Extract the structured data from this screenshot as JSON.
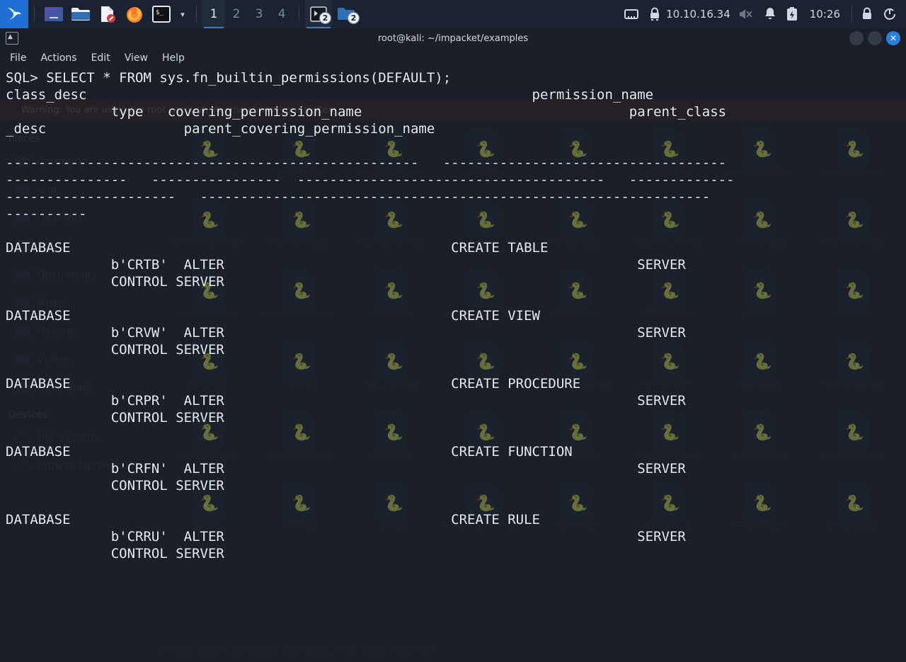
{
  "taskbar": {
    "launchers": [
      {
        "name": "kali-menu-icon",
        "glyph": "kali-dragon"
      },
      {
        "name": "workspace-preview-icon",
        "glyph": "screen"
      },
      {
        "name": "file-manager-icon",
        "glyph": "folder"
      },
      {
        "name": "text-editor-icon",
        "glyph": "document"
      },
      {
        "name": "firefox-icon",
        "glyph": "firefox"
      },
      {
        "name": "terminal-icon",
        "glyph": "terminal"
      }
    ],
    "terminal_prompt": "$_",
    "chevron": "▾",
    "workspaces": [
      {
        "label": "1",
        "active": true
      },
      {
        "label": "2",
        "active": false
      },
      {
        "label": "3",
        "active": false
      },
      {
        "label": "4",
        "active": false
      }
    ],
    "windows": [
      {
        "name": "terminal-window-group",
        "badge": "2",
        "active": true
      },
      {
        "name": "file-manager-window-group",
        "badge": "2",
        "active": false
      }
    ],
    "tray": {
      "network_icon": "network-icon",
      "vpn_icon": "vpn-lock-icon",
      "ip_address": "10.10.16.34",
      "volume_icon": "volume-muted-icon",
      "notification_icon": "bell-icon",
      "battery_icon": "battery-icon",
      "clock": "10:26",
      "lock_icon": "lock-icon",
      "logout_icon": "logout-icon"
    }
  },
  "terminal": {
    "title": "root@kali: ~/impacket/examples",
    "menus": [
      "File",
      "Actions",
      "Edit",
      "View",
      "Help"
    ],
    "window_controls": {
      "minimize": "",
      "maximize": "",
      "close": "✕"
    },
    "lines": [
      "SQL> SELECT * FROM sys.fn_builtin_permissions(DEFAULT);",
      "class_desc                                                       permission_name",
      "             type   covering_permission_name                                 parent_class",
      "_desc                 parent_covering_permission_name",
      "",
      "---------------------------------------------------   -----------------------------------",
      "---------------   ----------------  --------------------------------------   -------------",
      "---------------------   ---------------------------------------------------------------",
      "----------",
      "",
      "DATABASE                                               CREATE TABLE",
      "             b'CRTB'  ALTER                                                   SERVER",
      "             CONTROL SERVER",
      "",
      "DATABASE                                               CREATE VIEW",
      "             b'CRVW'  ALTER                                                   SERVER",
      "             CONTROL SERVER",
      "",
      "DATABASE                                               CREATE PROCEDURE",
      "             b'CRPR'  ALTER                                                   SERVER",
      "             CONTROL SERVER",
      "",
      "DATABASE                                               CREATE FUNCTION",
      "             b'CRFN'  ALTER                                                   SERVER",
      "             CONTROL SERVER",
      "",
      "DATABASE                                               CREATE RULE",
      "             b'CRRU'  ALTER                                                   SERVER",
      "             CONTROL SERVER"
    ]
  },
  "file_manager": {
    "warning": "Warning: You are using the root account. You may harm your system.",
    "sidebar": {
      "places_label": "Places",
      "devices_label": "Devices",
      "places": [
        "Computer",
        "root",
        "Desktop",
        "Trash",
        "Documents",
        "Music",
        "Pictures",
        "Videos",
        "Downloads"
      ],
      "devices": [
        "File System",
        "Browse Network"
      ]
    },
    "files": [
      "GetADUsers.py",
      "getArch.py",
      "GetNPUsers.py",
      "getPac.py",
      "getST.py",
      "getTGT.py",
      "GetUserSPNs.py",
      "goldenPac.py",
      "GPPPassword.py",
      "karmaSMB.py",
      "keylistattack.py",
      "kintercept.py",
      "lookupsid.py",
      "machine_role.py",
      "mimikatz.py",
      "mqtt_check.py",
      "mssqlclient.py",
      "mssqlinstance.py",
      "netview.py",
      "nmapAnswerMachine.py",
      "ntfs-read.py",
      "ntlmrelayx.py",
      "ping.py",
      "ping6.py",
      "psexec.py",
      "rbcd.py",
      "rdp_check.py",
      "reg.py",
      "registry-read.py",
      "rpcdump.py",
      "rpcmap.py",
      "sambaPipe.py",
      "samrdump.py",
      "secretsdump.py",
      "services.py",
      "smbclient.py",
      "smbexec.py",
      "smbpasswd.py",
      "smbrelayx.py",
      "smbserver.py",
      "sniff.py",
      "sniffer.py",
      "split.py",
      "ticketConverter.py",
      "ticketer.py",
      "wmiexec.py",
      "wmipersist.py",
      "wmiquery.py"
    ],
    "status": "57 files: 1022.5 KiB (1,047,086 bytes), Free space: 60.4 GiB"
  },
  "colors": {
    "accent": "#2b7fdd",
    "taskbar_bg": "#1b2330",
    "terminal_bg": "#171b23",
    "text": "#e8eef5"
  }
}
